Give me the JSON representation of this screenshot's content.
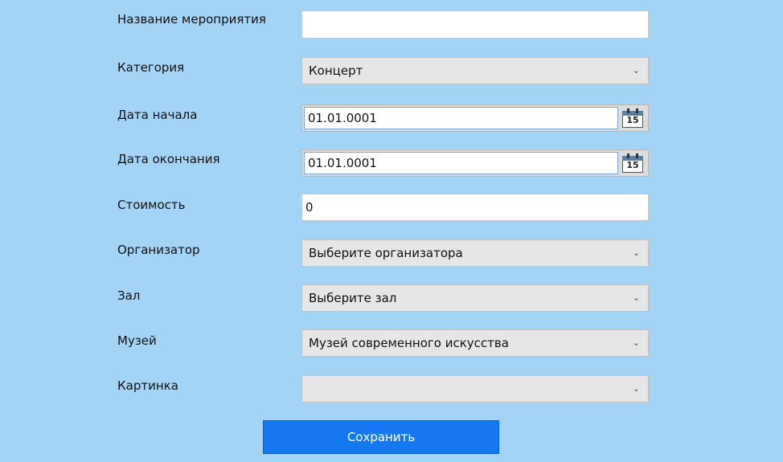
{
  "fields": {
    "event_name": {
      "label": "Название мероприятия",
      "value": ""
    },
    "category": {
      "label": "Категория",
      "value": "Концерт"
    },
    "start_date": {
      "label": "Дата начала",
      "value": "01.01.0001",
      "calendar_day": "15"
    },
    "end_date": {
      "label": "Дата окончания",
      "value": "01.01.0001",
      "calendar_day": "15"
    },
    "cost": {
      "label": "Стоимость",
      "value": "0"
    },
    "organizer": {
      "label": "Организатор",
      "value": "Выберите организатора"
    },
    "hall": {
      "label": "Зал",
      "value": "Выберите зал"
    },
    "museum": {
      "label": "Музей",
      "value": "Музей современного искусства"
    },
    "picture": {
      "label": "Картинка",
      "value": ""
    }
  },
  "save_button": {
    "label": "Сохранить"
  },
  "icons": {
    "dropdown": "chevron-down-icon",
    "calendar": "calendar-icon"
  },
  "colors": {
    "background": "#a3d4f6",
    "accent": "#1479f0"
  }
}
